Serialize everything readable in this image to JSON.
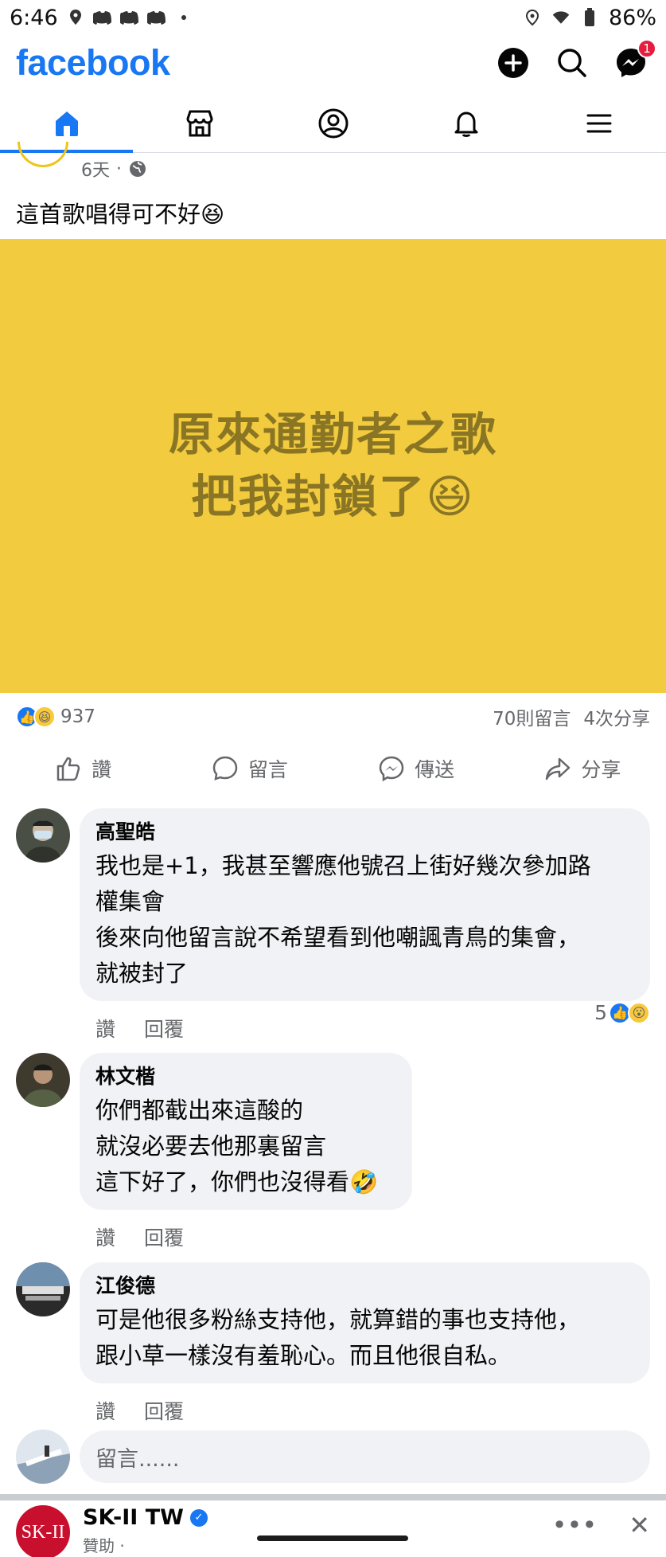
{
  "status_bar": {
    "time": "6:46",
    "battery": "86%"
  },
  "header": {
    "logo": "facebook",
    "messenger_badge": "1"
  },
  "tabs": [
    {
      "name": "home",
      "active": true
    },
    {
      "name": "marketplace",
      "active": false
    },
    {
      "name": "profile",
      "active": false
    },
    {
      "name": "notifications",
      "active": false
    },
    {
      "name": "menu",
      "active": false
    }
  ],
  "post": {
    "time": "6天",
    "dot": "·",
    "text": "這首歌唱得可不好😆",
    "image_lines": [
      "原來通勤者之歌",
      "把我封鎖了😆"
    ],
    "image_bg": "#f2cb3e",
    "reaction_count": "937",
    "comments_count": "70則留言",
    "shares_count": "4次分享"
  },
  "actions": {
    "like": "讚",
    "comment": "留言",
    "send": "傳送",
    "share": "分享"
  },
  "comments": [
    {
      "name": "高聖皓",
      "lines": [
        "我也是+1，我甚至響應他號召上街好幾次參加路",
        "權集會",
        "後來向他留言說不希望看到他嘲諷青鳥的集會，",
        "就被封了"
      ],
      "like": "讚",
      "reply": "回覆",
      "reaction_count": "5"
    },
    {
      "name": "林文楷",
      "lines": [
        "你們都截出來這酸的",
        "就沒必要去他那裏留言",
        "這下好了，你們也沒得看🤣"
      ],
      "like": "讚",
      "reply": "回覆"
    },
    {
      "name": "江俊德",
      "lines": [
        "可是他很多粉絲支持他，就算錯的事也支持他，",
        "跟小草一樣沒有羞恥心。而且他很自私。"
      ],
      "like": "讚",
      "reply": "回覆"
    }
  ],
  "write_comment": {
    "placeholder": "留言......"
  },
  "sponsored": {
    "avatar_text": "SK-II",
    "name": "SK-II TW",
    "sub": "贊助 ·"
  },
  "colors": {
    "brand": "#1877f2",
    "badge": "#e41e3f"
  }
}
